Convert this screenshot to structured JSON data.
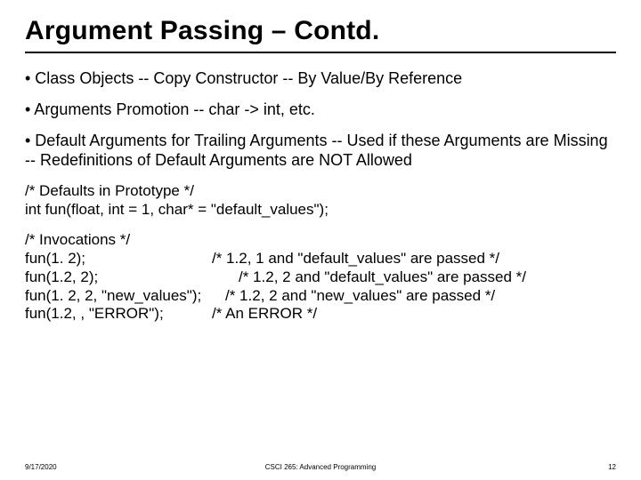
{
  "title": "Argument Passing – Contd.",
  "bullets": [
    "• Class Objects -- Copy Constructor -- By Value/By Reference",
    "• Arguments Promotion -- char -> int, etc.",
    "• Default Arguments for Trailing Arguments -- Used if these Arguments are Missing -- Redefinitions of Default Arguments are NOT Allowed"
  ],
  "code_proto": {
    "comment": "/* Defaults in Prototype */",
    "line": "int fun(float, int = 1, char* = \"default_values\");"
  },
  "code_invocations": {
    "header": "/* Invocations */",
    "lines": [
      {
        "call": "fun(1. 2);",
        "note": "/* 1.2, 1 and \"default_values\" are passed */"
      },
      {
        "call": "fun(1.2, 2);",
        "note": "/* 1.2, 2 and \"default_values\" are passed */"
      },
      {
        "call": "fun(1. 2, 2, \"new_values\");",
        "note": "/* 1.2, 2 and \"new_values\" are passed */"
      },
      {
        "call": "fun(1.2, , \"ERROR\");",
        "note": "/* An ERROR */"
      }
    ]
  },
  "footer": {
    "date": "9/17/2020",
    "course": "CSCI 265: Advanced Programming",
    "page": "12"
  }
}
